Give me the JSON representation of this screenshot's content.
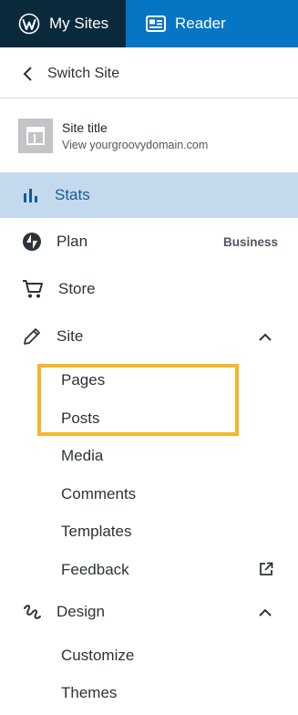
{
  "topbar": {
    "my_sites": "My Sites",
    "reader": "Reader"
  },
  "switch_site": {
    "label": "Switch Site"
  },
  "site": {
    "title": "Site title",
    "url": "View yourgroovydomain.com"
  },
  "nav": {
    "stats": "Stats",
    "plan": "Plan",
    "plan_badge": "Business",
    "store": "Store",
    "site": "Site",
    "design": "Design"
  },
  "site_submenu": [
    "Pages",
    "Posts",
    "Media",
    "Comments",
    "Templates",
    "Feedback"
  ],
  "design_submenu": [
    "Customize",
    "Themes"
  ],
  "colors": {
    "topbar_dark": "#0a2a3c",
    "topbar_blue": "#0675c4",
    "active_bg": "#c5d9ed",
    "active_text": "#135e96",
    "highlight": "#f7b62a"
  }
}
